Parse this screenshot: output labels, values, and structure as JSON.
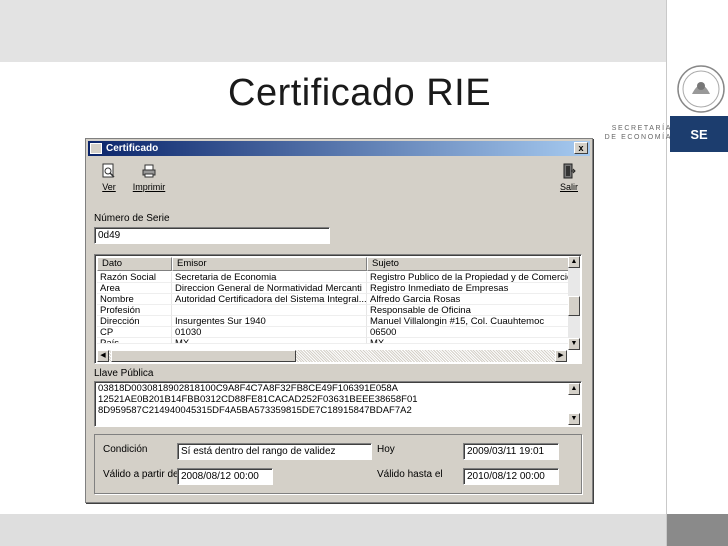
{
  "slide": {
    "title": "Certificado RIE",
    "logo": {
      "ministry_line1": "SECRETARÍA",
      "ministry_line2": "DE ECONOMÍA",
      "badge": "SE"
    }
  },
  "window": {
    "title": "Certificado",
    "close_glyph": "x",
    "toolbar": {
      "ver": {
        "label": "Ver",
        "icon": "magnifier-page-icon"
      },
      "imprimir": {
        "label": "Imprimir",
        "icon": "printer-icon"
      },
      "salir": {
        "label": "Salir",
        "icon": "exit-door-icon"
      }
    },
    "serial": {
      "label": "Número de Serie",
      "value": "0d49"
    },
    "grid": {
      "columns": [
        "Dato",
        "Emisor",
        "Sujeto"
      ],
      "rows": [
        [
          "Razón Social",
          "Secretaria de Economia",
          "Registro Publico de la Propiedad y de Comercio de"
        ],
        [
          "Area",
          "Direccion General de Normatividad Mercanti",
          "Registro Inmediato de Empresas"
        ],
        [
          "Nombre",
          "Autoridad Certificadora del Sistema Integral...",
          "Alfredo Garcia Rosas"
        ],
        [
          "Profesión",
          "",
          "Responsable de Oficina"
        ],
        [
          "Dirección",
          "Insurgentes Sur 1940",
          "Manuel Villalongin #15, Col. Cuauhtemoc"
        ],
        [
          "CP",
          "01030",
          "06500"
        ],
        [
          "País",
          "MX",
          "MX"
        ]
      ]
    },
    "public_key": {
      "label": "Llave Pública",
      "lines": [
        "03818D0030818902818100C9A8F4C7A8F32FB8CE49F106391E058A",
        "12521AE0B201B14FBB0312CD88FE81CACAD252F03631BEEE38658F01",
        "8D959587C214940045315DF4A5BA573359815DE7C18915847BDAF7A2"
      ]
    },
    "validity": {
      "condition_label": "Condición",
      "condition_value": "Sí está dentro del rango de validez",
      "today_label": "Hoy",
      "today_value": "2009/03/11  19:01",
      "from_label": "Válido a partir de",
      "from_value": "2008/08/12  00:00",
      "until_label": "Válido hasta el",
      "until_value": "2010/08/12  00:00"
    }
  },
  "colors": {
    "accent": "#1c3d6e",
    "window_face": "#d4d0c8",
    "titlebar": "#0a246a"
  }
}
